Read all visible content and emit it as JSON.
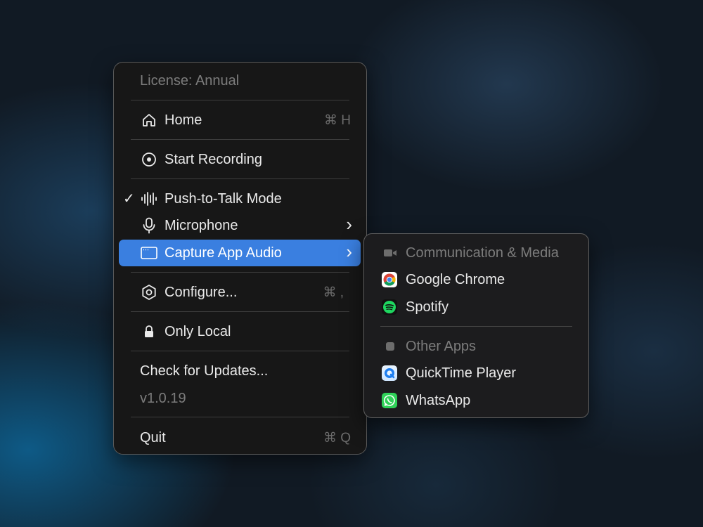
{
  "menu": {
    "license": "License: Annual",
    "home": {
      "label": "Home",
      "shortcut": "⌘ H",
      "icon": "home-icon"
    },
    "start_recording": {
      "label": "Start Recording",
      "icon": "record-icon"
    },
    "push_to_talk": {
      "label": "Push-to-Talk Mode",
      "checked": true,
      "check": "✓",
      "icon": "waveform-icon"
    },
    "microphone": {
      "label": "Microphone",
      "icon": "microphone-icon",
      "submenu": "›"
    },
    "capture_app_audio": {
      "label": "Capture App Audio",
      "icon": "window-icon",
      "submenu": "›",
      "highlighted": true
    },
    "configure": {
      "label": "Configure...",
      "shortcut": "⌘ ,",
      "icon": "gear-icon"
    },
    "only_local": {
      "label": "Only Local",
      "icon": "lock-icon"
    },
    "check_updates": {
      "label": "Check for Updates..."
    },
    "version": "v1.0.19",
    "quit": {
      "label": "Quit",
      "shortcut": "⌘ Q"
    }
  },
  "submenu": {
    "group1": {
      "label": "Communication & Media",
      "icon": "video-icon"
    },
    "apps1": [
      {
        "label": "Google Chrome",
        "icon": "chrome-icon"
      },
      {
        "label": "Spotify",
        "icon": "spotify-icon"
      }
    ],
    "group2": {
      "label": "Other Apps",
      "icon": "square-icon"
    },
    "apps2": [
      {
        "label": "QuickTime Player",
        "icon": "quicktime-icon"
      },
      {
        "label": "WhatsApp",
        "icon": "whatsapp-icon"
      }
    ]
  },
  "colors": {
    "highlight": "#3a7fe0",
    "menu_bg": "#171717",
    "text": "#eaeaea",
    "dim_text": "#7c7c7c"
  }
}
